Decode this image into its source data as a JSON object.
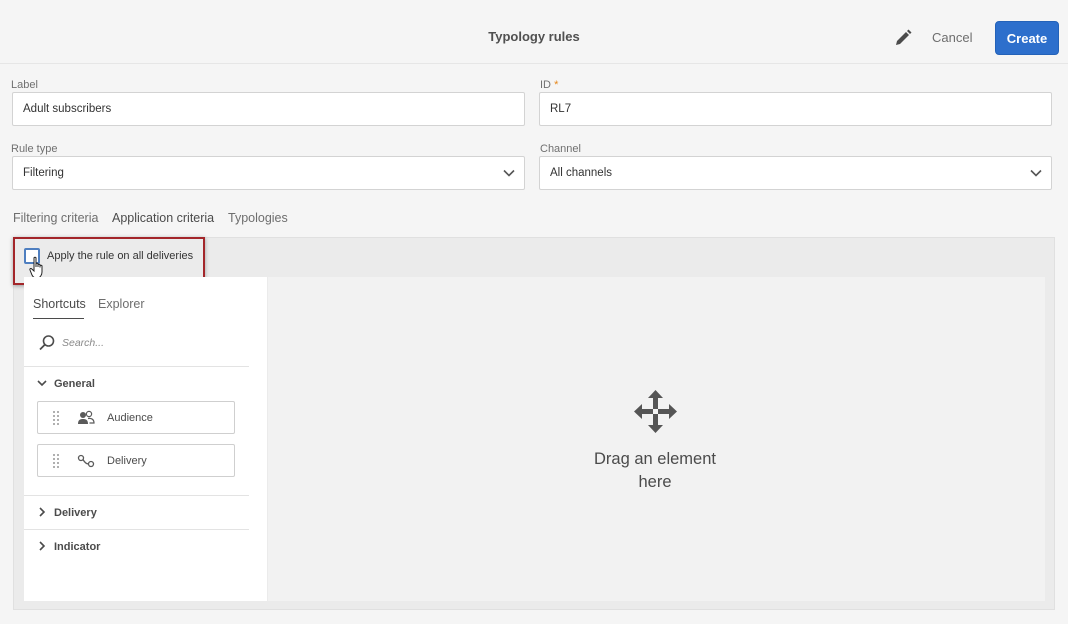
{
  "header": {
    "title": "Typology rules",
    "cancel_label": "Cancel",
    "create_label": "Create",
    "accent_color": "#2d6fcc"
  },
  "form": {
    "label_field": {
      "label": "Label",
      "value": "Adult subscribers"
    },
    "id_field": {
      "label": "ID",
      "required_mark": "*",
      "value": "RL7"
    },
    "rule_type": {
      "label": "Rule type",
      "selected": "Filtering"
    },
    "channel": {
      "label": "Channel",
      "selected": "All channels"
    }
  },
  "tabs": [
    {
      "label": "Filtering criteria",
      "active": false
    },
    {
      "label": "Application criteria",
      "active": true
    },
    {
      "label": "Typologies",
      "active": false
    }
  ],
  "criteria": {
    "apply_all_label": "Apply the rule on all deliveries",
    "apply_all_checked": false,
    "highlight_color": "#a3262a"
  },
  "sidebar": {
    "tabs": [
      {
        "label": "Shortcuts",
        "active": true
      },
      {
        "label": "Explorer",
        "active": false
      }
    ],
    "search_placeholder": "Search...",
    "groups": [
      {
        "label": "General",
        "expanded": true,
        "items": [
          {
            "label": "Audience",
            "icon": "audience-icon"
          },
          {
            "label": "Delivery",
            "icon": "delivery-icon"
          }
        ]
      },
      {
        "label": "Delivery",
        "expanded": false
      },
      {
        "label": "Indicator",
        "expanded": false
      }
    ]
  },
  "drop_zone": {
    "line1": "Drag an element",
    "line2": "here",
    "icon": "move-icon"
  }
}
